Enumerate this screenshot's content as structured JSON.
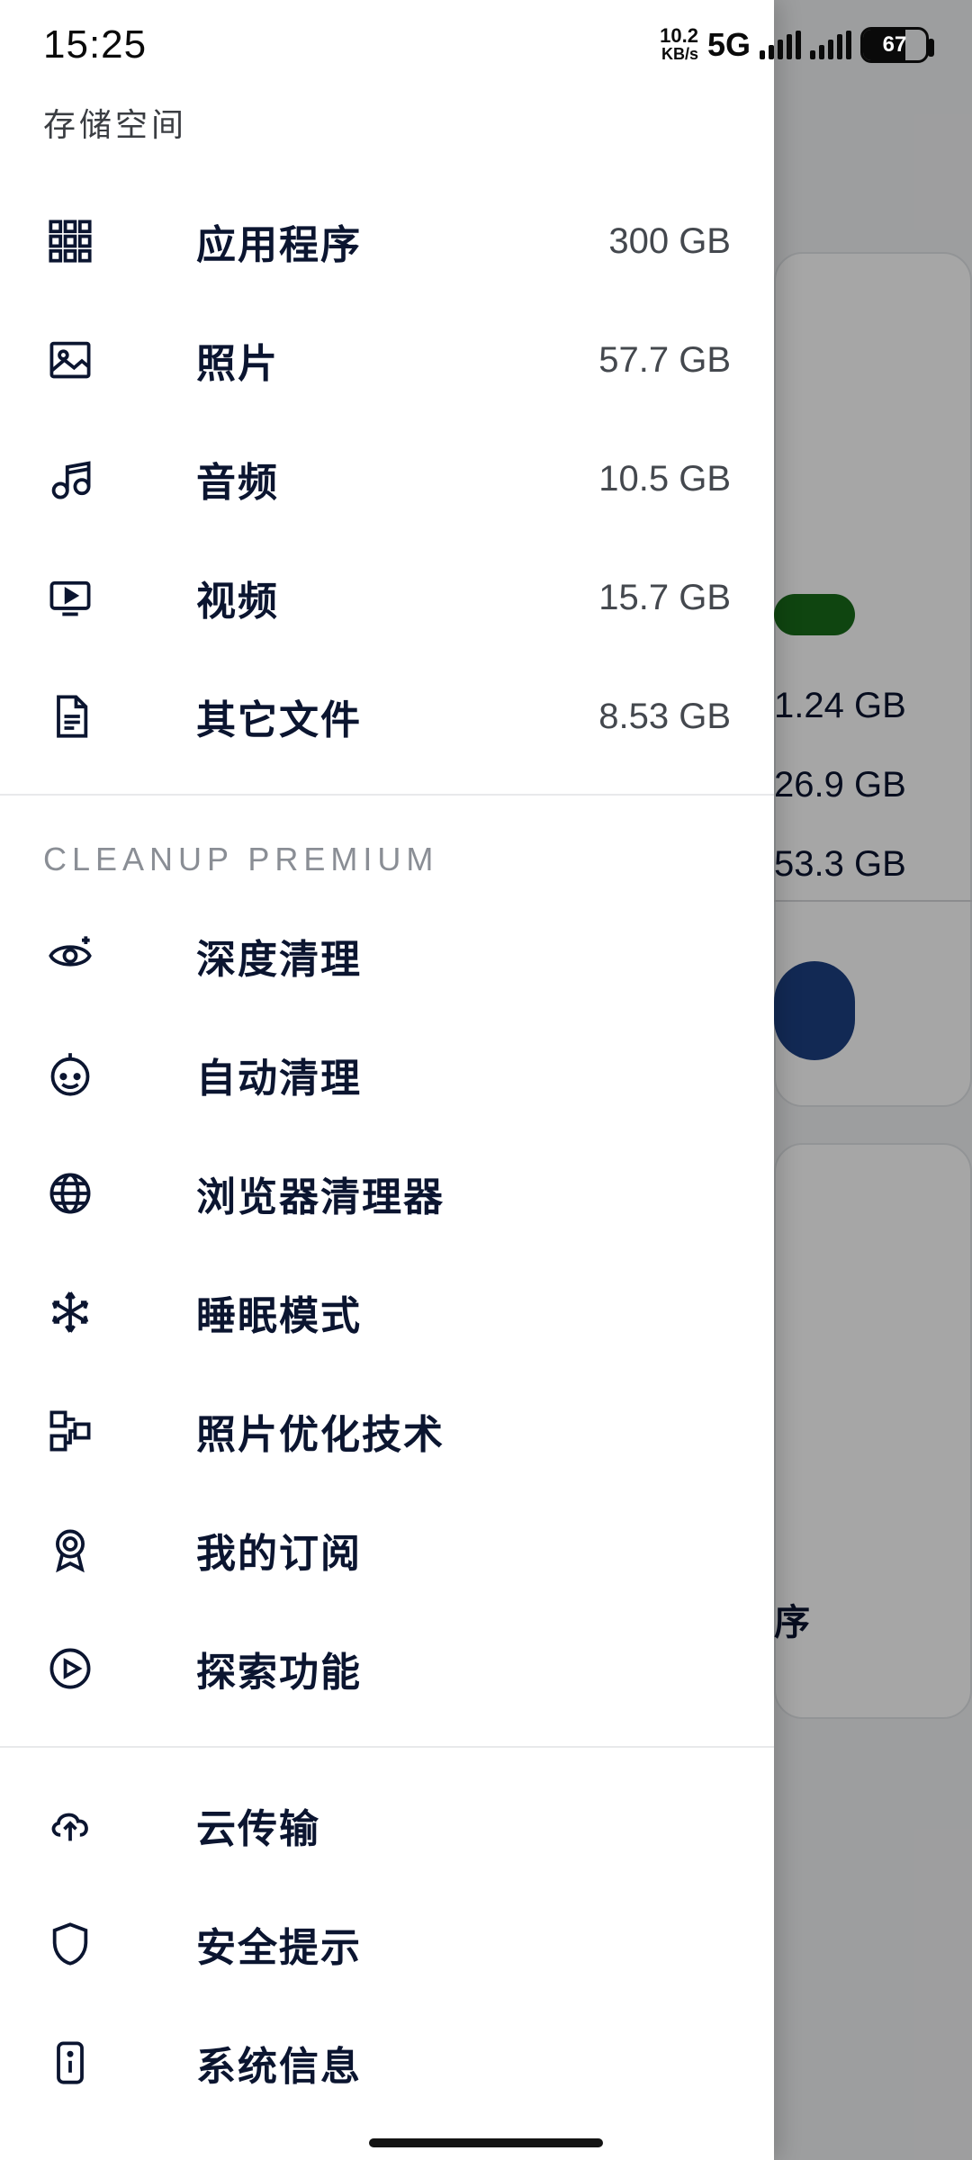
{
  "statusbar": {
    "time": "15:25",
    "net_speed_top": "10.2",
    "net_speed_bottom": "KB/s",
    "net_type": "5G",
    "battery_pct": "67"
  },
  "drawer": {
    "header": "存储空间",
    "storage": [
      {
        "icon": "apps",
        "label": "应用程序",
        "value": "300 GB"
      },
      {
        "icon": "photo",
        "label": "照片",
        "value": "57.7 GB"
      },
      {
        "icon": "audio",
        "label": "音频",
        "value": "10.5 GB"
      },
      {
        "icon": "video",
        "label": "视频",
        "value": "15.7 GB"
      },
      {
        "icon": "file",
        "label": "其它文件",
        "value": "8.53 GB"
      }
    ],
    "premium_title": "CLEANUP PREMIUM",
    "premium": [
      {
        "icon": "eye",
        "label": "深度清理"
      },
      {
        "icon": "robot",
        "label": "自动清理"
      },
      {
        "icon": "globe",
        "label": "浏览器清理器"
      },
      {
        "icon": "snow",
        "label": "睡眠模式"
      },
      {
        "icon": "optimize",
        "label": "照片优化技术"
      },
      {
        "icon": "badge",
        "label": "我的订阅"
      },
      {
        "icon": "play",
        "label": "探索功能"
      }
    ],
    "other": [
      {
        "icon": "cloud",
        "label": "云传输"
      },
      {
        "icon": "shield",
        "label": "安全提示"
      },
      {
        "icon": "info",
        "label": "系统信息"
      }
    ]
  },
  "background": {
    "stat1": "1.24 GB",
    "stat2": "26.9 GB",
    "stat3": "53.3 GB",
    "card2_label": "序"
  }
}
